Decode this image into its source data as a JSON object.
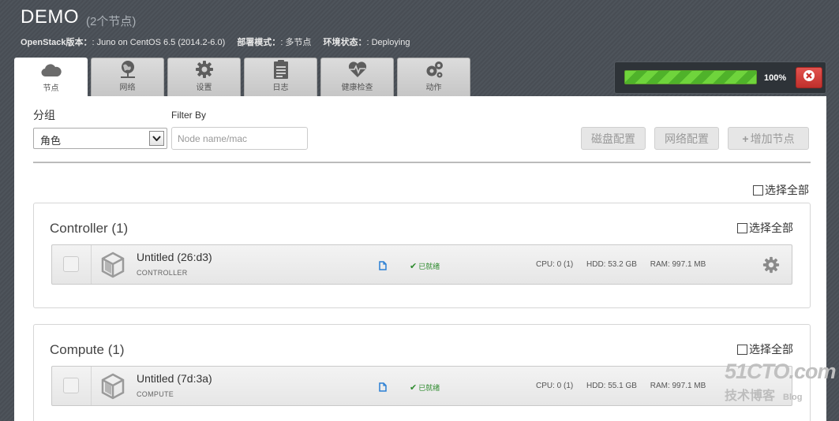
{
  "header": {
    "title": "DEMO",
    "subtitle": "(2个节点)",
    "meta": [
      {
        "label": "OpenStack版本：",
        "value": ": Juno on CentOS 6.5 (2014.2-6.0)"
      },
      {
        "label": "部署模式：",
        "value": ": 多节点"
      },
      {
        "label": "环境状态：",
        "value": ": Deploying"
      }
    ]
  },
  "tabs": [
    {
      "label": "节点",
      "icon": "cloud-icon"
    },
    {
      "label": "网络",
      "icon": "globe-network-icon"
    },
    {
      "label": "设置",
      "icon": "gear-icon"
    },
    {
      "label": "日志",
      "icon": "document-icon"
    },
    {
      "label": "健康检查",
      "icon": "heart-pulse-icon"
    },
    {
      "label": "动作",
      "icon": "gears-icon"
    }
  ],
  "progress": {
    "percent": 100,
    "label": "100%"
  },
  "toolbar": {
    "group_label": "分组",
    "group_value": "角色",
    "filter_label": "Filter By",
    "filter_placeholder": "Node name/mac",
    "disk_config": "磁盘配置",
    "network_config": "网络配置",
    "add_nodes": "增加节点",
    "select_all": "选择全部"
  },
  "groups": [
    {
      "title": "Controller (1)",
      "select_all": "选择全部",
      "nodes": [
        {
          "name": "Untitled (26:d3)",
          "role": "CONTROLLER",
          "status": "已就绪",
          "cpu": "CPU: 0 (1)",
          "hdd": "HDD: 53.2 GB",
          "ram": "RAM: 997.1 MB"
        }
      ]
    },
    {
      "title": "Compute (1)",
      "select_all": "选择全部",
      "nodes": [
        {
          "name": "Untitled (7d:3a)",
          "role": "COMPUTE",
          "status": "已就绪",
          "cpu": "CPU: 0 (1)",
          "hdd": "HDD: 55.1 GB",
          "ram": "RAM: 997.1 MB"
        }
      ]
    }
  ],
  "watermark": {
    "line1": "51CTO.com",
    "line2": "技术博客",
    "line3": "Blog"
  },
  "colors": {
    "progress_green": "#4fb22a",
    "close_red": "#c9302c",
    "status_green": "#2e8b2e"
  }
}
